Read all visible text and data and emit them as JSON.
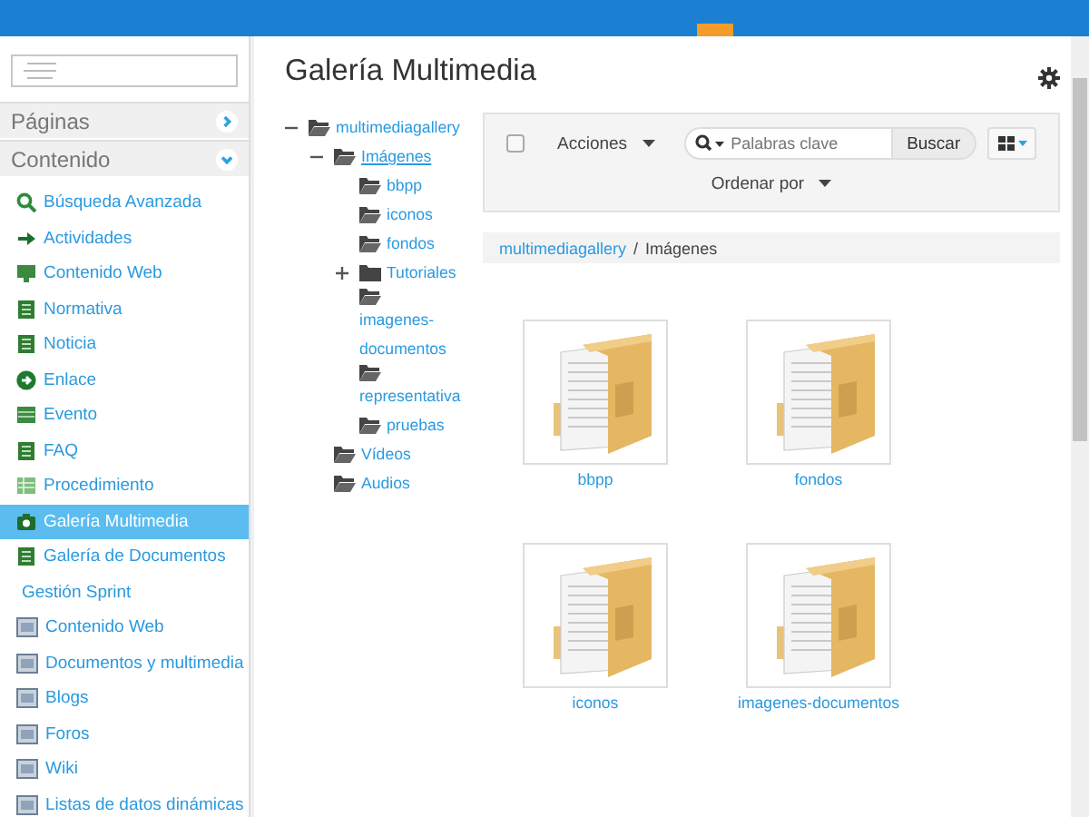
{
  "sidebar": {
    "sections": [
      {
        "label": "Páginas",
        "expanded": false
      },
      {
        "label": "Contenido",
        "expanded": true
      }
    ],
    "items": [
      {
        "label": "Búsqueda Avanzada",
        "kind": "search",
        "selected": false
      },
      {
        "label": "Actividades",
        "kind": "arrow",
        "selected": false
      },
      {
        "label": "Contenido Web",
        "kind": "monitor",
        "selected": false
      },
      {
        "label": "Normativa",
        "kind": "structure",
        "selected": false
      },
      {
        "label": "Noticia",
        "kind": "structure",
        "selected": false
      },
      {
        "label": "Enlace",
        "kind": "link",
        "selected": false
      },
      {
        "label": "Evento",
        "kind": "calendar",
        "selected": false
      },
      {
        "label": "FAQ",
        "kind": "structure",
        "selected": false
      },
      {
        "label": "Procedimiento",
        "kind": "sheet",
        "selected": false
      },
      {
        "label": "Galería Multimedia",
        "kind": "camera",
        "selected": true
      },
      {
        "label": "Galería de Documentos",
        "kind": "structure",
        "selected": false
      },
      {
        "label": "Gestión Sprint",
        "kind": "heading",
        "selected": false
      },
      {
        "label": "Contenido Web",
        "kind": "app",
        "selected": false
      },
      {
        "label": "Documentos y multimedia",
        "kind": "app",
        "selected": false
      },
      {
        "label": "Blogs",
        "kind": "app",
        "selected": false
      },
      {
        "label": "Foros",
        "kind": "app",
        "selected": false
      },
      {
        "label": "Wiki",
        "kind": "app",
        "selected": false
      },
      {
        "label": "Listas de datos dinámicas",
        "kind": "app",
        "selected": false
      }
    ]
  },
  "page": {
    "title": "Galería Multimedia"
  },
  "tree": [
    {
      "label": "multimediagallery",
      "expanded": true,
      "selected": false,
      "children": [
        {
          "label": "Imágenes",
          "expanded": true,
          "selected": true,
          "children": [
            {
              "label": "bbpp",
              "selected": false
            },
            {
              "label": "iconos",
              "selected": false
            },
            {
              "label": "fondos",
              "selected": false
            },
            {
              "label": "Tutoriales",
              "expanded": false,
              "selected": false
            },
            {
              "label": "imagenes-documentos",
              "selected": false
            },
            {
              "label": "representativa",
              "selected": false
            },
            {
              "label": "pruebas",
              "selected": false
            }
          ]
        },
        {
          "label": "Vídeos",
          "selected": false
        },
        {
          "label": "Audios",
          "selected": false
        }
      ]
    }
  ],
  "toolbar": {
    "select_all": {
      "checked": false
    },
    "actions": "Acciones",
    "search": {
      "placeholder": "Palabras clave"
    },
    "search_button": "Buscar",
    "sort": "Ordenar por"
  },
  "breadcrumb": {
    "items": [
      "multimediagallery",
      "Imágenes"
    ],
    "separator": "/"
  },
  "folders": [
    {
      "name": "bbpp"
    },
    {
      "name": "fondos"
    },
    {
      "name": "iconos"
    },
    {
      "name": "imagenes-documentos"
    }
  ]
}
